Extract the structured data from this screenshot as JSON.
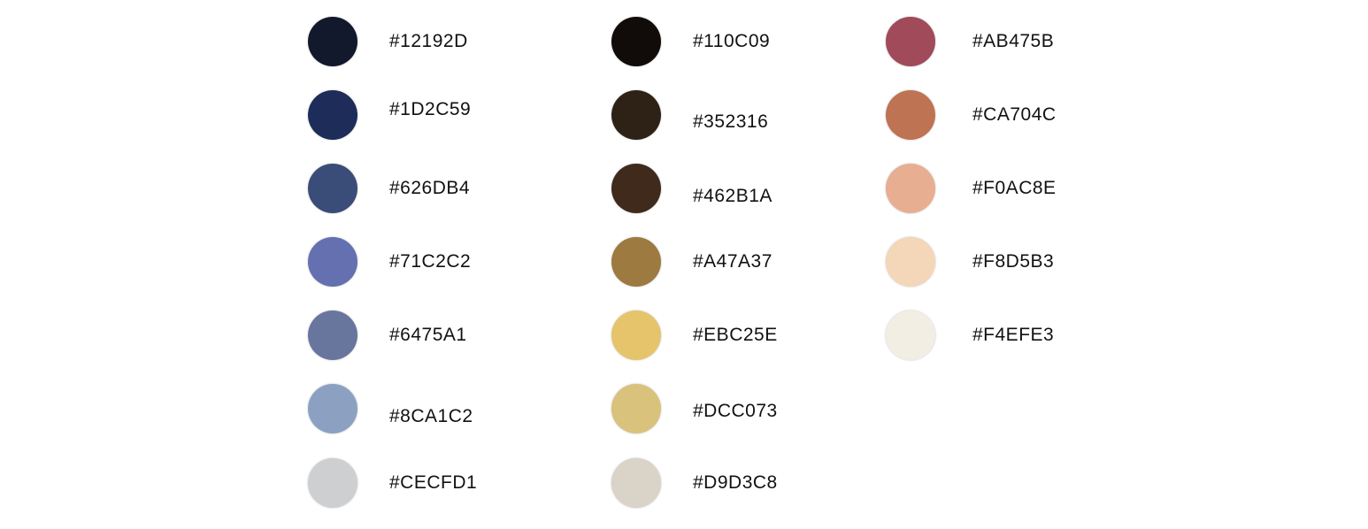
{
  "palette": {
    "columns": [
      {
        "swatches": [
          {
            "hex": "#12192D",
            "label": "#12192D"
          },
          {
            "hex": "#1D2C59",
            "label": "#1D2C59"
          },
          {
            "hex": "#3A4D78",
            "label": "#626DB4"
          },
          {
            "hex": "#6470B0",
            "label": "#71C2C2"
          },
          {
            "hex": "#68769E",
            "label": "#6475A1"
          },
          {
            "hex": "#8CA1C2",
            "label": "#8CA1C2"
          },
          {
            "hex": "#CECFD1",
            "label": "#CECFD1"
          }
        ]
      },
      {
        "swatches": [
          {
            "hex": "#110C09",
            "label": "#110C09"
          },
          {
            "hex": "#2E2116",
            "label": "#352316"
          },
          {
            "hex": "#3F2A1C",
            "label": "#462B1A"
          },
          {
            "hex": "#9C7A40",
            "label": "#A47A37"
          },
          {
            "hex": "#E5C46C",
            "label": "#EBC25E"
          },
          {
            "hex": "#D9C27B",
            "label": "#DCC073"
          },
          {
            "hex": "#D9D3C8",
            "label": "#D9D3C8"
          }
        ]
      },
      {
        "swatches": [
          {
            "hex": "#A04A5A",
            "label": "#AB475B"
          },
          {
            "hex": "#BE7352",
            "label": "#CA704C"
          },
          {
            "hex": "#E8AE92",
            "label": "#F0AC8E"
          },
          {
            "hex": "#F4D6B8",
            "label": "#F8D5B3"
          },
          {
            "hex": "#F3EEE4",
            "label": "#F4EFE3"
          }
        ]
      }
    ]
  }
}
